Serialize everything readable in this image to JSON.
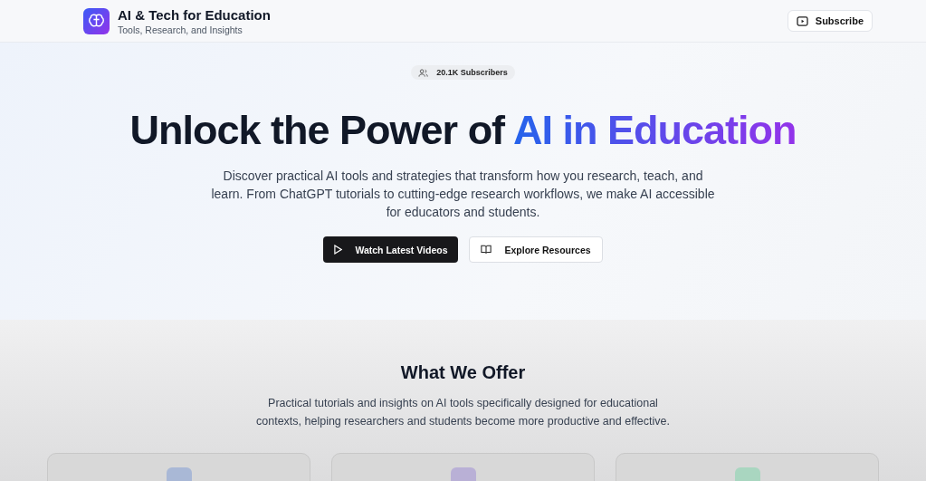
{
  "header": {
    "title": "AI & Tech for Education",
    "subtitle": "Tools, Research, and Insights",
    "subscribe_button": "Subscribe"
  },
  "hero": {
    "badge": "20.1K Subscribers",
    "title": "Unlock the Power of ",
    "title_highlight": "AI in Education",
    "description": "Discover practical AI tools and strategies that transform how you research, teach, and learn. From ChatGPT tutorials to cutting-edge research workflows, we make AI accessible for educators and students.",
    "buttons": [
      {
        "label": "Watch Latest Videos",
        "kind": "primary"
      },
      {
        "label": "Explore Resources",
        "kind": "secondary"
      }
    ]
  },
  "offer": {
    "title": "What We Offer",
    "description": "Practical tutorials and insights on AI tools specifically designed for educational contexts, helping researchers and students become more productive and effective.",
    "cards": [
      {
        "color": "#a9b8d6"
      },
      {
        "color": "#b9b0d6"
      },
      {
        "color": "#a9d6c0"
      }
    ]
  }
}
